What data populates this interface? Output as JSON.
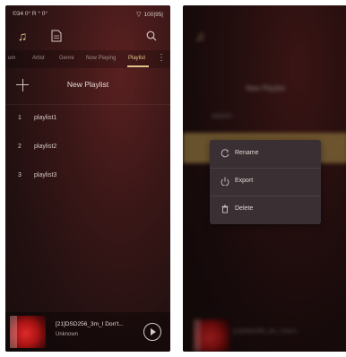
{
  "left_screen": {
    "status": {
      "left": "©34 0° R ° 0°",
      "right": "100|95|"
    },
    "tabs": [
      {
        "label": "um"
      },
      {
        "label": "Artist"
      },
      {
        "label": "Genre"
      },
      {
        "label": "Now Playing"
      },
      {
        "label": "Playlist",
        "active": true
      }
    ],
    "new_playlist_label": "New Playlist",
    "playlists": [
      {
        "num": "1",
        "name": "playlist1"
      },
      {
        "num": "2",
        "name": "playlist2"
      },
      {
        "num": "3",
        "name": "playlist3"
      }
    ],
    "now_playing": {
      "title": "[21]DSD256_3m_I Don't...",
      "artist": "Unknown"
    }
  },
  "right_screen": {
    "blurred": {
      "new_playlist": "New Playlist",
      "row1": "playlist1",
      "now_title": "[21]DSD256_3m_I Don't..."
    },
    "context_menu": [
      {
        "label": "Rename",
        "icon": "rename-icon"
      },
      {
        "label": "Export",
        "icon": "export-icon"
      },
      {
        "label": "Delete",
        "icon": "trash-icon"
      }
    ]
  },
  "colors": {
    "accent": "#e4c58e",
    "background": "#2a1214",
    "menu_bg": "#3a3033"
  }
}
